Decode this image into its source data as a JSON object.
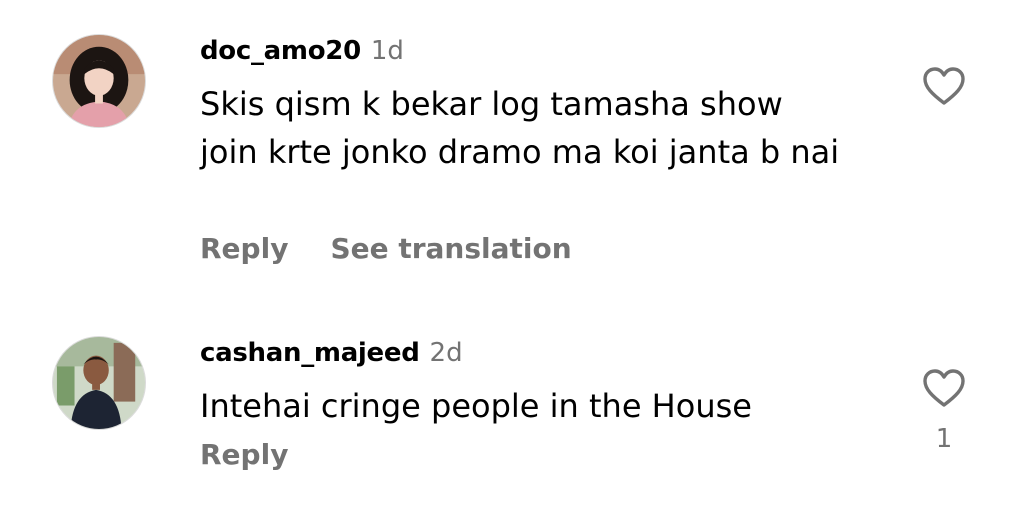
{
  "comments": [
    {
      "username": "doc_amo20",
      "time": "1d",
      "text": "Skis qism k bekar log tamasha show join krte jonko dramo ma koi janta b nai",
      "reply_label": "Reply",
      "translate_label": "See translation",
      "like_count": "",
      "avatar_icon": "avatar-photo-icon",
      "like_icon": "heart-outline-icon"
    },
    {
      "username": "cashan_majeed",
      "time": "2d",
      "text": "Intehai cringe people in the House",
      "reply_label": "Reply",
      "translate_label": "",
      "like_count": "1",
      "avatar_icon": "avatar-photo-icon",
      "like_icon": "heart-outline-icon"
    }
  ],
  "colors": {
    "text": "#000000",
    "secondary": "#737373",
    "background": "#ffffff"
  }
}
